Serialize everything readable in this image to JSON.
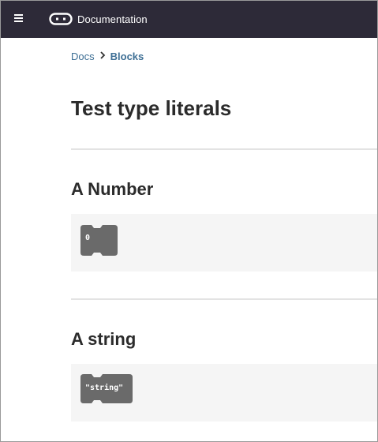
{
  "header": {
    "menu_icon": "hamburger-menu-icon",
    "logo_icon": "microbit-logo-icon",
    "title": "Documentation",
    "background": "#2d2a38"
  },
  "breadcrumb": {
    "items": [
      {
        "label": "Docs"
      },
      {
        "label": "Blocks"
      }
    ],
    "separator_icon": "chevron-right-icon",
    "link_color": "#3e6f95"
  },
  "page": {
    "title": "Test type literals"
  },
  "sections": [
    {
      "title": "A Number",
      "block_value": "0",
      "block_color": "#6a6a6a"
    },
    {
      "title": "A string",
      "block_value": "\"string\"",
      "block_color": "#6a6a6a"
    }
  ]
}
